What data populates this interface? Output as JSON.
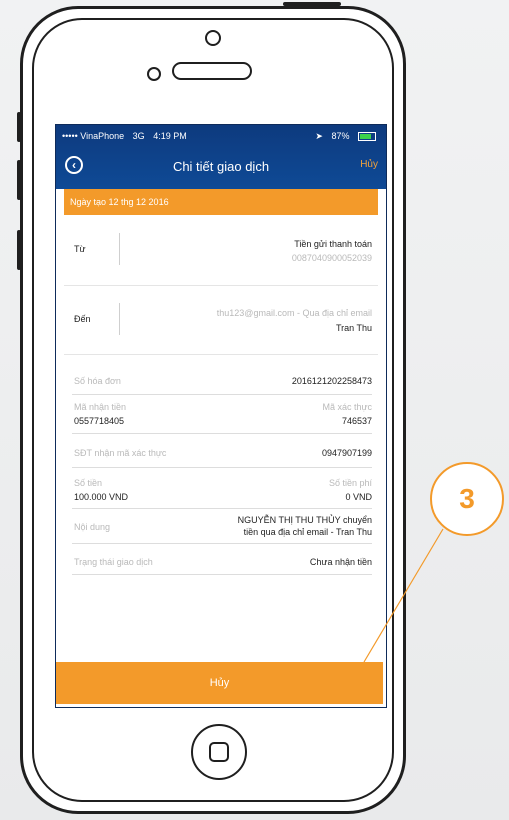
{
  "status_bar": {
    "carrier": "••••• VinaPhone",
    "network": "3G",
    "time": "4:19 PM",
    "battery": "87%"
  },
  "nav": {
    "title": "Chi tiết giao dịch",
    "cancel": "Hủy"
  },
  "created_date": "Ngày tạo 12 thg 12 2016",
  "from": {
    "label": "Từ",
    "account_name": "Tiền gửi thanh toán",
    "account_number": "0087040900052039"
  },
  "to": {
    "label": "Đến",
    "email": "thu123@gmail.com - Qua địa chỉ email",
    "name": "Tran Thu"
  },
  "details": {
    "invoice_label": "Số hóa đơn",
    "invoice_value": "2016121202258473",
    "receive_code_label": "Mã nhận tiền",
    "receive_code_value": "0557718405",
    "verify_code_label": "Mã xác thực",
    "verify_code_value": "746537",
    "phone_label": "SĐT nhận mã xác thực",
    "phone_value": "0947907199",
    "amount_label": "Số tiền",
    "amount_value": "100.000 VND",
    "fee_label": "Số tiền phí",
    "fee_value": "0 VND",
    "content_label": "Nội dung",
    "content_line1": "NGUYỄN THỊ THU THỦY chuyển",
    "content_line2": "tiền qua địa chỉ email - Tran Thu",
    "state_label": "Trạng thái giao dịch",
    "state_value": "Chưa nhận tiền"
  },
  "cancel_button": "Hủy",
  "callout": "3",
  "colors": {
    "accent": "#f39a2a",
    "header": "#0f4a96"
  }
}
